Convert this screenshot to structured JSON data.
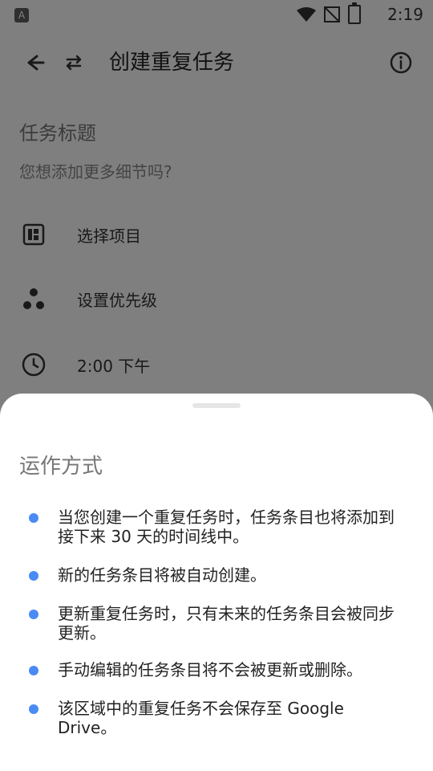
{
  "status_bar": {
    "time": "2:19",
    "icons": [
      "accessibility-icon",
      "wifi-icon",
      "no-signal-icon",
      "battery-charging-icon"
    ],
    "left_icon_text": "A"
  },
  "app_bar": {
    "title": "创建重复任务",
    "icons": [
      "back-icon",
      "repeat-icon",
      "info-icon"
    ]
  },
  "form": {
    "task_title_placeholder": "任务标题",
    "more_details_prompt": "您想添加更多细节吗?",
    "items": [
      {
        "icon": "project-icon",
        "label": "选择项目"
      },
      {
        "icon": "priority-icon",
        "label": "设置优先级"
      },
      {
        "icon": "clock-icon",
        "label": "2:00 下午"
      }
    ]
  },
  "sheet": {
    "title": "运作方式",
    "bullets": [
      "当您创建一个重复任务时，任务条目也将添加到接下来 30 天的时间线中。",
      "新的任务条目将被自动创建。",
      "更新重复任务时，只有未来的任务条目会被同步更新。",
      "手动编辑的任务条目将不会被更新或删除。",
      "该区域中的重复任务不会保存至 Google Drive。"
    ],
    "colors": {
      "bullet": "#4a8af4"
    }
  }
}
